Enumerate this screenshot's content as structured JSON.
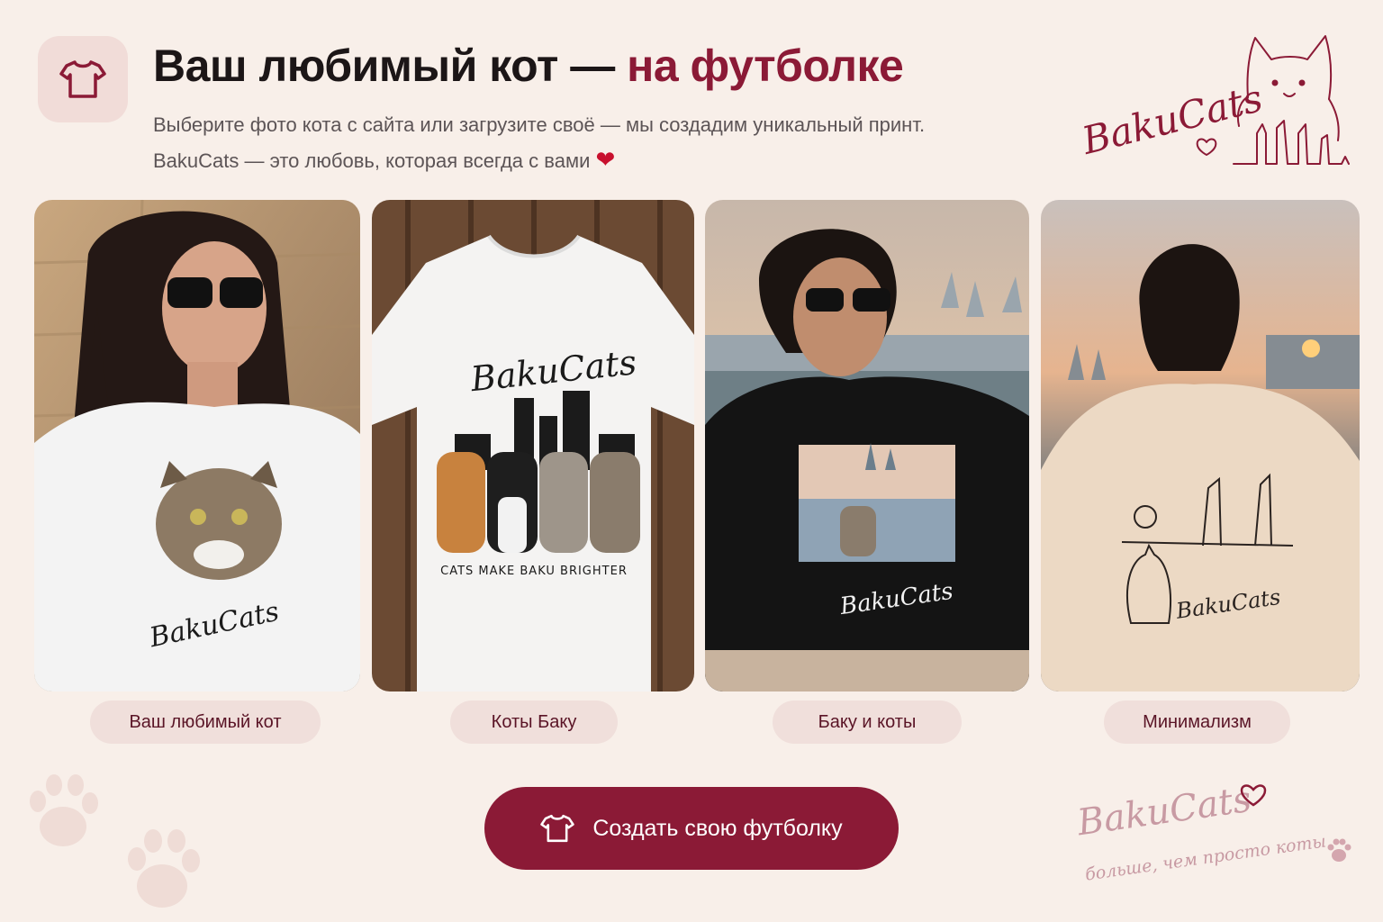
{
  "header": {
    "icon": "tshirt-icon",
    "title_main": "Ваш любимый кот — ",
    "title_accent": "на футболке",
    "subtitle_line1": "Выберите фото кота с сайта или загрузите своё — мы создадим уникальный принт.",
    "subtitle_line2": "BakuCats — это любовь, которая всегда с вами"
  },
  "logo": {
    "text": "BakuCats",
    "icon": "cat-skyline-logo"
  },
  "cards": [
    {
      "label": "Ваш любимый кот",
      "print_text": "BakuCats"
    },
    {
      "label": "Коты Баку",
      "print_title": "BakuCats",
      "print_caption": "CATS MAKE BAKU BRIGHTER"
    },
    {
      "label": "Баку и коты",
      "print_text": "BakuCats"
    },
    {
      "label": "Минимализм",
      "print_text": "BakuCats"
    }
  ],
  "cta": {
    "label": "Создать свою футболку",
    "icon": "tshirt-icon"
  },
  "signature": {
    "brand": "BakuCats",
    "tagline": "больше, чем просто коты"
  },
  "colors": {
    "accent": "#8b1a36",
    "background": "#f8efe9",
    "pill_bg": "#f0dfdb"
  }
}
